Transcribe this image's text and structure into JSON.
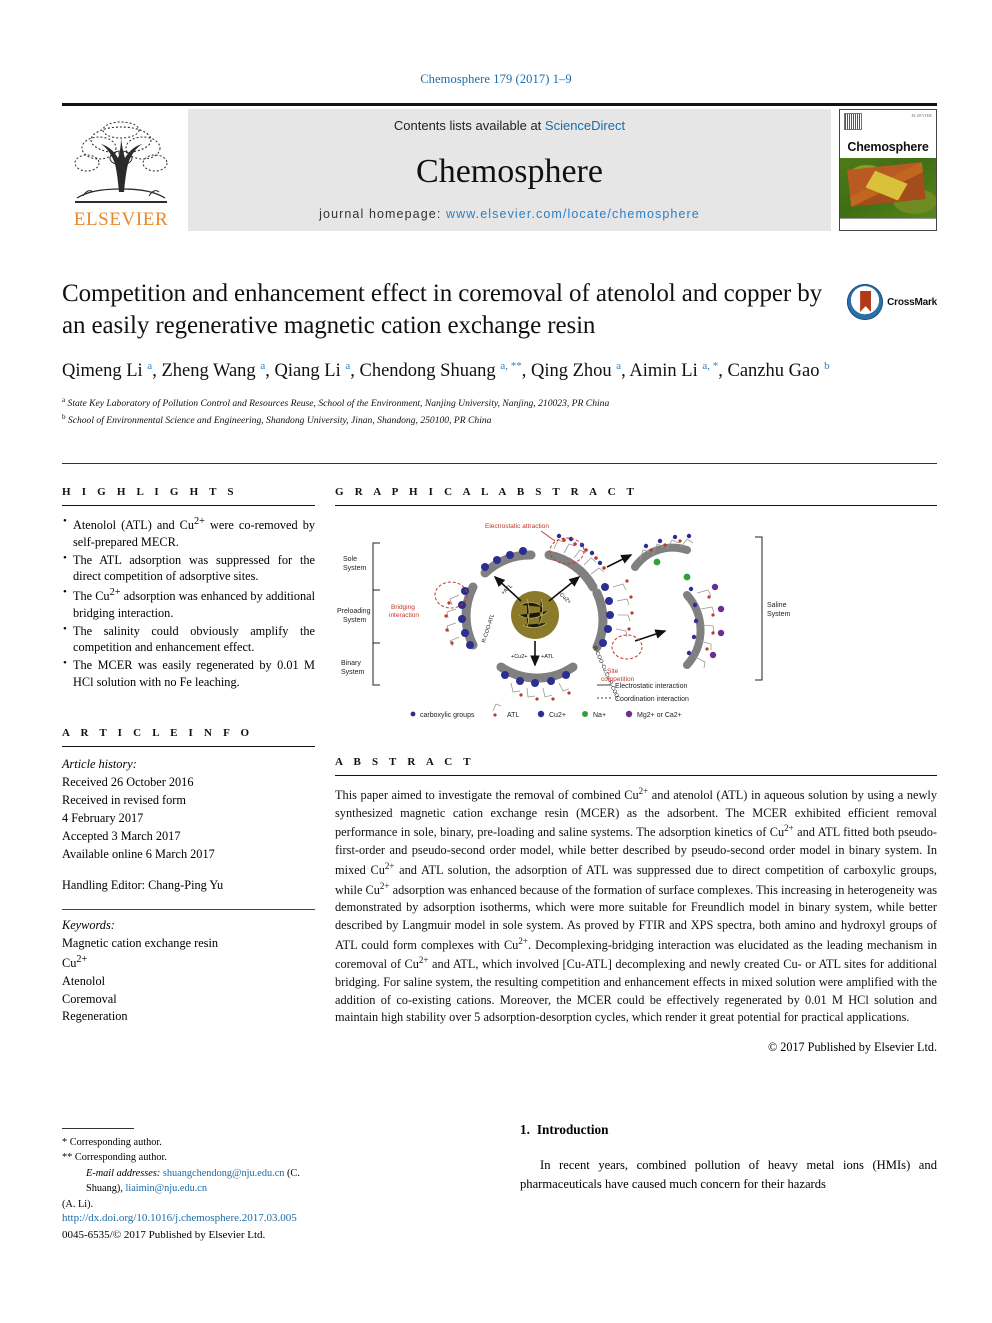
{
  "running_head": "Chemosphere 179 (2017) 1–9",
  "masthead": {
    "contents_prefix": "Contents lists available at ",
    "contents_link": "ScienceDirect",
    "journal_name": "Chemosphere",
    "homepage_prefix": "journal homepage: ",
    "homepage_url": "www.elsevier.com/locate/chemosphere",
    "publisher_wordmark": "ELSEVIER",
    "cover_title": "Chemosphere",
    "cover_publisher": "ELSEVIER"
  },
  "article": {
    "title": "Competition and enhancement effect in coremoval of atenolol and copper by an easily regenerative magnetic cation exchange resin",
    "crossmark_label": "CrossMark",
    "authors_html": "Qimeng Li <sup>a</sup>, Zheng Wang <sup>a</sup>, Qiang Li <sup>a</sup>, Chendong Shuang <sup>a, **</sup>, Qing Zhou <sup>a</sup>, Aimin Li <sup>a, *</sup>, Canzhu Gao <sup>b</sup>",
    "affiliations": [
      {
        "marker": "a",
        "text": "State Key Laboratory of Pollution Control and Resources Reuse, School of the Environment, Nanjing University, Nanjing, 210023, PR China"
      },
      {
        "marker": "b",
        "text": "School of Environmental Science and Engineering, Shandong University, Jinan, Shandong, 250100, PR China"
      }
    ]
  },
  "highlights": {
    "heading": "H I G H L I G H T S",
    "items_html": [
      "Atenolol (ATL) and Cu<sup>2+</sup> were co-removed by self-prepared MECR.",
      "The ATL adsorption was suppressed for the direct competition of adsorptive sites.",
      "The Cu<sup>2+</sup> adsorption was enhanced by additional bridging interaction.",
      "The salinity could obviously amplify the competition and enhancement effect.",
      "The MCER was easily regenerated by 0.01 M HCl solution with no Fe leaching."
    ]
  },
  "graphical_abstract": {
    "heading": "G R A P H I C A L   A B S T R A C T",
    "system_labels": [
      "Sole System",
      "Preloading System",
      "Binary System",
      "Saline System"
    ],
    "annotations": [
      "Electrostatic attraction",
      "Bridging interaction",
      "Site competition"
    ],
    "axis_notes": [
      "+ATL",
      "+Cu2+",
      "+Cu2+  +ATL",
      "R-COO-Cu-Cu-R-COO-",
      "R-COO-ATL"
    ],
    "legend_lines": [
      "— Electrostatic interaction",
      "---- Coordination interaction"
    ],
    "legend_keys": [
      "carboxylic groups",
      "ATL",
      "Cu2+",
      "Na+",
      "Mg2+ or Ca2+"
    ]
  },
  "article_info": {
    "heading": "A R T I C L E   I N F O",
    "history_label": "Article history:",
    "history_lines": [
      "Received 26 October 2016",
      "Received in revised form",
      "4 February 2017",
      "Accepted 3 March 2017",
      "Available online 6 March 2017"
    ],
    "handling_editor": "Handling Editor: Chang-Ping Yu",
    "keywords_label": "Keywords:",
    "keywords_html": [
      "Magnetic cation exchange resin",
      "Cu<sup>2+</sup>",
      "Atenolol",
      "Coremoval",
      "Regeneration"
    ]
  },
  "abstract": {
    "heading": "A B S T R A C T",
    "body_html": "This paper aimed to investigate the removal of combined Cu<sup>2+</sup> and atenolol (ATL) in aqueous solution by using a newly synthesized magnetic cation exchange resin (MCER) as the adsorbent. The MCER exhibited efficient removal performance in sole, binary, pre-loading and saline systems. The adsorption kinetics of Cu<sup>2+</sup> and ATL fitted both pseudo-first-order and pseudo-second order model, while better described by pseudo-second order model in binary system. In mixed Cu<sup>2+</sup> and ATL solution, the adsorption of ATL was suppressed due to direct competition of carboxylic groups, while Cu<sup>2+</sup> adsorption was enhanced because of the formation of surface complexes. This increasing in heterogeneity was demonstrated by adsorption isotherms, which were more suitable for Freundlich model in binary system, while better described by Langmuir model in sole system. As proved by FTIR and XPS spectra, both amino and hydroxyl groups of ATL could form complexes with Cu<sup>2+</sup>. Decomplexing-bridging interaction was elucidated as the leading mechanism in coremoval of Cu<sup>2+</sup> and ATL, which involved [Cu-ATL] decomplexing and newly created Cu- or ATL sites for additional bridging. For saline system, the resulting competition and enhancement effects in mixed solution were amplified with the addition of co-existing cations. Moreover, the MCER could be effectively regenerated by 0.01 M HCl solution and maintain high stability over 5 adsorption-desorption cycles, which render it great potential for practical applications.",
    "copyright": "© 2017 Published by Elsevier Ltd."
  },
  "footnotes": {
    "star_single": "* Corresponding author.",
    "star_double": "** Corresponding author.",
    "email_label": "E-mail addresses:",
    "email_1": "shuangchendong@nju.edu.cn",
    "email_1_owner": "(C. Shuang),",
    "email_2": "liaimin@nju.edu.cn",
    "email_2_owner": "(A. Li)."
  },
  "doi_block": {
    "doi_url": "http://dx.doi.org/10.1016/j.chemosphere.2017.03.005",
    "issn_line": "0045-6535/© 2017 Published by Elsevier Ltd."
  },
  "introduction": {
    "number": "1.",
    "heading": "Introduction",
    "paragraph": "In recent years, combined pollution of heavy metal ions (HMIs) and pharmaceuticals have caused much concern for their hazards"
  },
  "colors": {
    "link_blue": "#1b6ca8",
    "elsevier_orange": "#E8872B",
    "masthead_grey": "#e6e6e6",
    "annotation_red": "#c0392b"
  }
}
